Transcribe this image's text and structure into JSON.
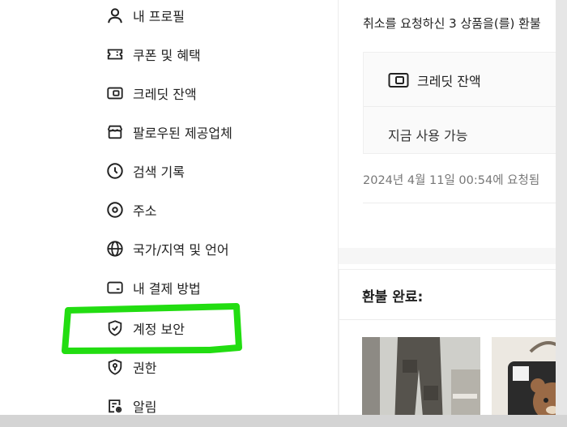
{
  "sidebar": {
    "items": [
      {
        "label": "내 프로필",
        "icon": "person-icon"
      },
      {
        "label": "쿠폰 및 혜택",
        "icon": "coupon-icon"
      },
      {
        "label": "크레딧 잔액",
        "icon": "credit-card-icon"
      },
      {
        "label": "팔로우된 제공업체",
        "icon": "store-icon"
      },
      {
        "label": "검색 기록",
        "icon": "clock-icon"
      },
      {
        "label": "주소",
        "icon": "location-pin-icon"
      },
      {
        "label": "국가/지역 및 언어",
        "icon": "globe-icon"
      },
      {
        "label": "내 결제 방법",
        "icon": "wallet-icon"
      },
      {
        "label": "계정 보안",
        "icon": "shield-check-icon"
      },
      {
        "label": "권한",
        "icon": "permission-shield-icon"
      },
      {
        "label": "알림",
        "icon": "notification-settings-icon"
      }
    ]
  },
  "main": {
    "cancel_text": "취소를 요청하신 3 상품을(를) 환불",
    "credit": {
      "title": "크레딧 잔액",
      "available": "지금 사용 가능"
    },
    "request_time": "2024년 4월 11일 00:54에 요청됨",
    "refund_title": "환불 완료:"
  },
  "colors": {
    "highlight": "#22dd11",
    "text": "#222222",
    "muted": "#777777"
  }
}
